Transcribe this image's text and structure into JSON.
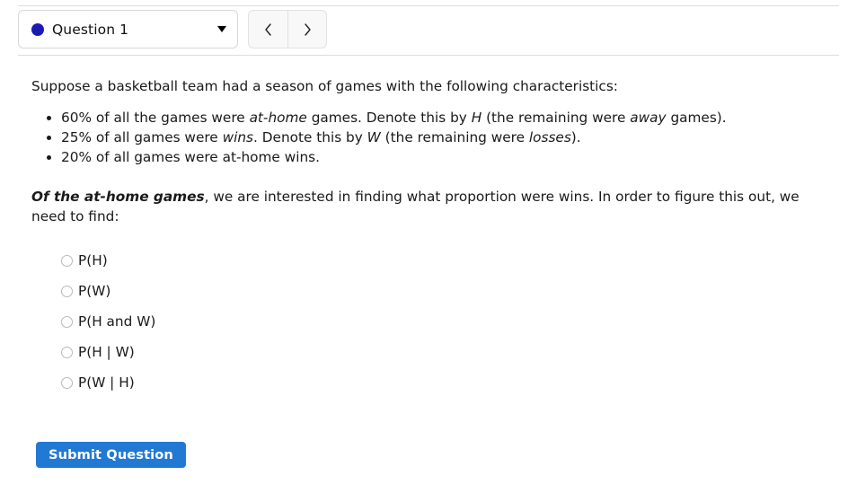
{
  "header": {
    "question_selector": {
      "label": "Question 1",
      "dot_color": "#1b1bb3",
      "caret_icon": "chevron-down-icon"
    },
    "prev_label": "‹",
    "next_label": "›"
  },
  "body": {
    "intro": "Suppose a basketball team had a season of games with the following characteristics:",
    "facts": [
      {
        "parts": [
          {
            "text": "60% of all the games were ",
            "style": "normal"
          },
          {
            "text": "at-home",
            "style": "italic"
          },
          {
            "text": " games. Denote this by ",
            "style": "normal"
          },
          {
            "text": "H",
            "style": "italic"
          },
          {
            "text": " (the remaining were ",
            "style": "normal"
          },
          {
            "text": "away",
            "style": "italic"
          },
          {
            "text": " games).",
            "style": "normal"
          }
        ]
      },
      {
        "parts": [
          {
            "text": "25% of all games were ",
            "style": "normal"
          },
          {
            "text": "wins",
            "style": "italic"
          },
          {
            "text": ". Denote this by ",
            "style": "normal"
          },
          {
            "text": "W",
            "style": "italic"
          },
          {
            "text": " (the remaining were ",
            "style": "normal"
          },
          {
            "text": "losses",
            "style": "italic"
          },
          {
            "text": ").",
            "style": "normal"
          }
        ]
      },
      {
        "parts": [
          {
            "text": "20% of all games were at-home wins.",
            "style": "normal"
          }
        ]
      }
    ],
    "prompt_lead": "Of the at-home games",
    "prompt_rest": ", we are interested in finding what proportion were wins. In order to figure this out, we need to find:",
    "options": [
      {
        "label": "P(H)",
        "selected": false
      },
      {
        "label": "P(W)",
        "selected": false
      },
      {
        "label": "P(H and W)",
        "selected": false
      },
      {
        "label": "P(H | W)",
        "selected": false
      },
      {
        "label": "P(W | H)",
        "selected": false
      }
    ]
  },
  "footer": {
    "submit_label": "Submit Question",
    "submit_color": "#2279d4"
  }
}
